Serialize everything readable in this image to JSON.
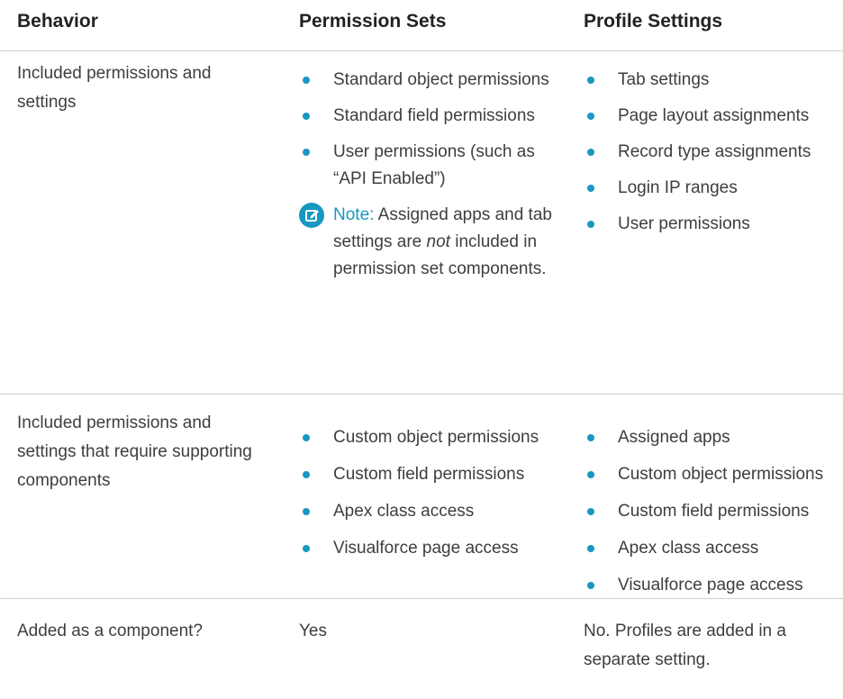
{
  "header": {
    "col1": "Behavior",
    "col2": "Permission Sets",
    "col3": "Profile Settings"
  },
  "rows": [
    {
      "behavior": "Included permissions and settings",
      "permission_sets": [
        "Standard object permissions",
        "Standard field permissions",
        "User permissions (such as “API Enabled”)"
      ],
      "note": {
        "label": "Note:",
        "text_before": "Assigned apps and tab settings are",
        "emphasis": "not",
        "text_after": "included in permission set components.",
        "icon": "edit-note-icon"
      },
      "profile_settings": [
        "Tab settings",
        "Page layout assignments",
        "Record type assignments",
        "Login IP ranges",
        "User permissions"
      ]
    },
    {
      "behavior": "Included permissions and settings that require supporting components",
      "permission_sets": [
        "Custom object permissions",
        "Custom field permissions",
        "Apex class access",
        "Visualforce page access"
      ],
      "profile_settings": [
        "Assigned apps",
        "Custom object permissions",
        "Custom field permissions",
        "Apex class access",
        "Visualforce page access"
      ]
    },
    {
      "behavior": "Added as a component?",
      "permission_sets_text": "Yes",
      "profile_settings_text": "No. Profiles are added in a separate setting."
    }
  ],
  "colors": {
    "accent": "#1798c1",
    "text": "#3e3e3c",
    "divider": "#cfcfcf"
  }
}
